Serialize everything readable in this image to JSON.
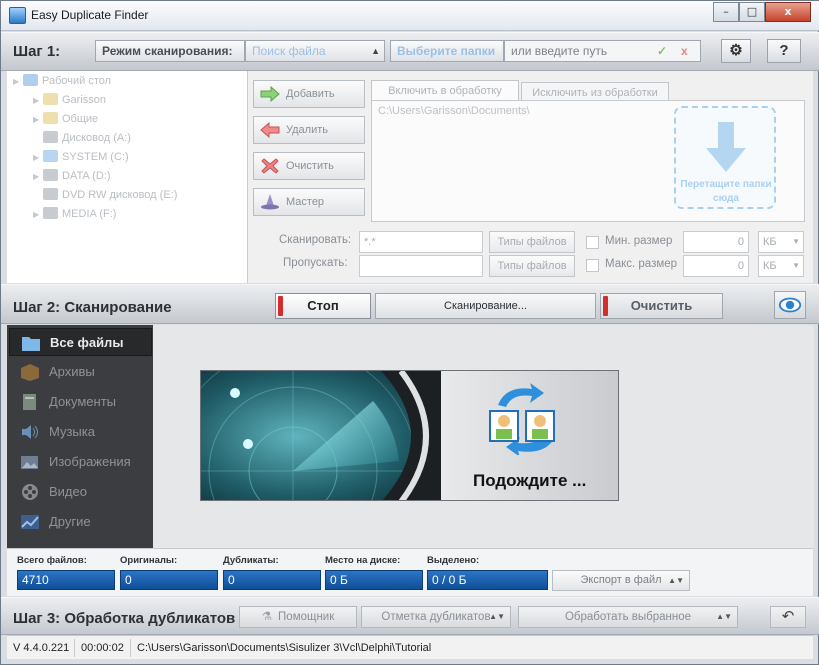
{
  "window": {
    "title": "Easy Duplicate Finder",
    "minimize": "–",
    "maximize": "□",
    "close": "x"
  },
  "step1": {
    "label": "Шаг 1:",
    "mode_label": "Режим сканирования:",
    "mode_value": "Поиск файла",
    "choose_folder": "Выберите папки",
    "path_placeholder": "или введите путь",
    "ok_mark": "✓",
    "cancel_mark": "x",
    "settings": "⚙",
    "help": "?"
  },
  "tree": {
    "items": [
      {
        "label": "Рабочий стол",
        "color": "#6fa6de"
      },
      {
        "label": "Garisson",
        "color": "#e0c46c"
      },
      {
        "label": "Общие",
        "color": "#e0c46c"
      },
      {
        "label": "Дисковод (A:)",
        "color": "#9aa1a8"
      },
      {
        "label": "SYSTEM (C:)",
        "color": "#7fb4e6"
      },
      {
        "label": "DATA (D:)",
        "color": "#9aa1a8"
      },
      {
        "label": "DVD RW дисковод (E:)",
        "color": "#9aa1a8"
      },
      {
        "label": "MEDIA (F:)",
        "color": "#9aa1a8"
      }
    ]
  },
  "actions": {
    "add": "Добавить",
    "remove": "Удалить",
    "clear": "Очистить",
    "wizard": "Мастер"
  },
  "tabs": {
    "include": "Включить в обработку",
    "exclude": "Исключить из обработки"
  },
  "include_path": "C:\\Users\\Garisson\\Documents\\",
  "drop_hint": "Перетащите папки сюда",
  "filters": {
    "scan_label": "Сканировать:",
    "scan_value": "*.*",
    "skip_label": "Пропускать:",
    "skip_value": "",
    "file_types": "Типы файлов",
    "min_size_label": "Мин. размер",
    "min_size_value": "0",
    "max_size_label": "Макс. размер",
    "max_size_value": "0",
    "unit": "КБ"
  },
  "step2": {
    "label": "Шаг 2: Сканирование",
    "stop": "Стоп",
    "progress": "Сканирование...",
    "clear": "Очистить"
  },
  "categories": [
    {
      "label": "Все файлы",
      "selected": true
    },
    {
      "label": "Архивы"
    },
    {
      "label": "Документы"
    },
    {
      "label": "Музыка"
    },
    {
      "label": "Изображения"
    },
    {
      "label": "Видео"
    },
    {
      "label": "Другие"
    }
  ],
  "wait_text": "Подождите ...",
  "stats": {
    "total_label": "Всего файлов:",
    "total_value": "4710",
    "originals_label": "Оригиналы:",
    "originals_value": "0",
    "dups_label": "Дубликаты:",
    "dups_value": "0",
    "disk_label": "Место на диске:",
    "disk_value": "0 Б",
    "sel_label": "Выделено:",
    "sel_value": "0 / 0 Б",
    "export": "Экспорт в файл"
  },
  "step3": {
    "label": "Шаг 3: Обработка дубликатов",
    "assistant": "Помощник",
    "mark": "Отметка дубликатов",
    "process": "Обработать выбранное"
  },
  "status": {
    "version": "V 4.4.0.221",
    "time": "00:00:02",
    "path": "C:\\Users\\Garisson\\Documents\\Sisulizer 3\\Vcl\\Delphi\\Tutorial"
  }
}
